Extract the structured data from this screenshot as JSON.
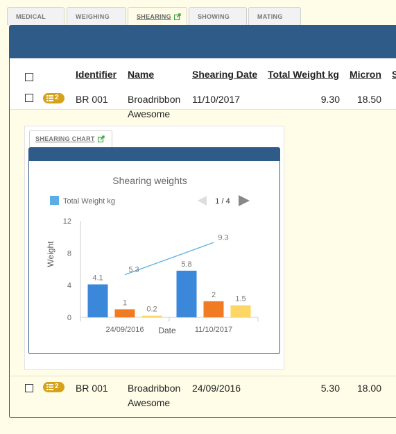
{
  "tabs": [
    {
      "label": "MEDICAL"
    },
    {
      "label": "WEIGHING"
    },
    {
      "label": "SHEARING"
    },
    {
      "label": "SHOWING"
    },
    {
      "label": "MATING"
    }
  ],
  "table": {
    "columns": {
      "identifier": "Identifier",
      "name": "Name",
      "shearing_date": "Shearing Date",
      "total_weight": "Total Weight kg",
      "micron": "Micron",
      "next": "S"
    },
    "rows": [
      {
        "badge": "2",
        "identifier": "BR 001",
        "name_line1": "Broadribbon",
        "name_line2": "Awesome",
        "shearing_date": "11/10/2017",
        "total_weight": "9.30",
        "micron": "18.50"
      },
      {
        "badge": "2",
        "identifier": "BR 001",
        "name_line1": "Broadribbon",
        "name_line2": "Awesome",
        "shearing_date": "24/09/2016",
        "total_weight": "5.30",
        "micron": "18.00"
      }
    ]
  },
  "chart_panel": {
    "tab_label": "SHEARING CHART",
    "pager": "1 / 4"
  },
  "colors": {
    "header_bar": "#2e5b87",
    "bar_blue": "#3b87d9",
    "bar_orange": "#f07b22",
    "bar_yellow": "#fcd766",
    "line": "#5aaee8",
    "badge": "#d6a21a",
    "background": "#fffde8"
  },
  "chart_data": {
    "type": "bar",
    "title": "Shearing weights",
    "xlabel": "Date",
    "ylabel": "Weight",
    "ylim": [
      0,
      12
    ],
    "yticks": [
      "0",
      "4",
      "8",
      "12"
    ],
    "categories": [
      "24/09/2016",
      "11/10/2017"
    ],
    "series": [
      {
        "name": "Total Weight kg",
        "values": [
          4.1,
          5.8
        ],
        "labels": [
          "4.1",
          "5.8"
        ]
      },
      {
        "values": [
          1,
          2
        ],
        "labels": [
          "1",
          "2"
        ]
      },
      {
        "values": [
          0.2,
          1.5
        ],
        "labels": [
          "0.2",
          "1.5"
        ]
      }
    ],
    "line": {
      "values": [
        5.3,
        9.3
      ],
      "labels": [
        "5.3",
        "9.3"
      ]
    },
    "legend": {
      "position": "top-left",
      "label": "Total Weight kg"
    }
  }
}
